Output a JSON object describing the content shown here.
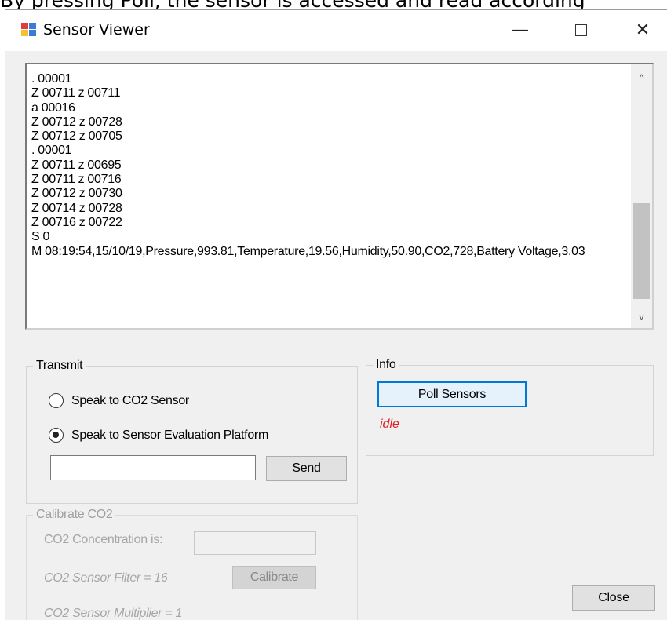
{
  "caption": "By pressing Poll, the sensor is accessed and read according",
  "window": {
    "title": "Sensor Viewer",
    "minimize_glyph": "—",
    "close_glyph": "✕"
  },
  "log": {
    "text": ". 00001\nZ 00711 z 00711\na 00016\nZ 00712 z 00728\nZ 00712 z 00705\n. 00001\nZ 00711 z 00695\nZ 00711 z 00716\nZ 00712 z 00730\nZ 00714 z 00728\nZ 00716 z 00722\nS 0\nM 08:19:54,15/10/19,Pressure,993.81,Temperature,19.56,Humidity,50.90,CO2,728,Battery Voltage,3.03",
    "scroll_up_glyph": "^",
    "scroll_down_glyph": "v"
  },
  "transmit": {
    "label": "Transmit",
    "option_co2": "Speak to CO2 Sensor",
    "option_platform": "Speak to Sensor Evaluation Platform",
    "input_value": "",
    "send_label": "Send"
  },
  "info": {
    "label": "Info",
    "poll_label": "Poll Sensors",
    "status": "idle"
  },
  "calibrate": {
    "label": "Calibrate CO2",
    "concentration_label": "CO2 Concentration is:",
    "concentration_value": "",
    "filter_label": "CO2 Sensor Filter = 16",
    "multiplier_label": "CO2 Sensor Multiplier = 1",
    "calibrate_label": "Calibrate"
  },
  "footer": {
    "close_label": "Close"
  },
  "colors": {
    "accent": "#0078d7",
    "status_idle": "#e11b1b"
  }
}
